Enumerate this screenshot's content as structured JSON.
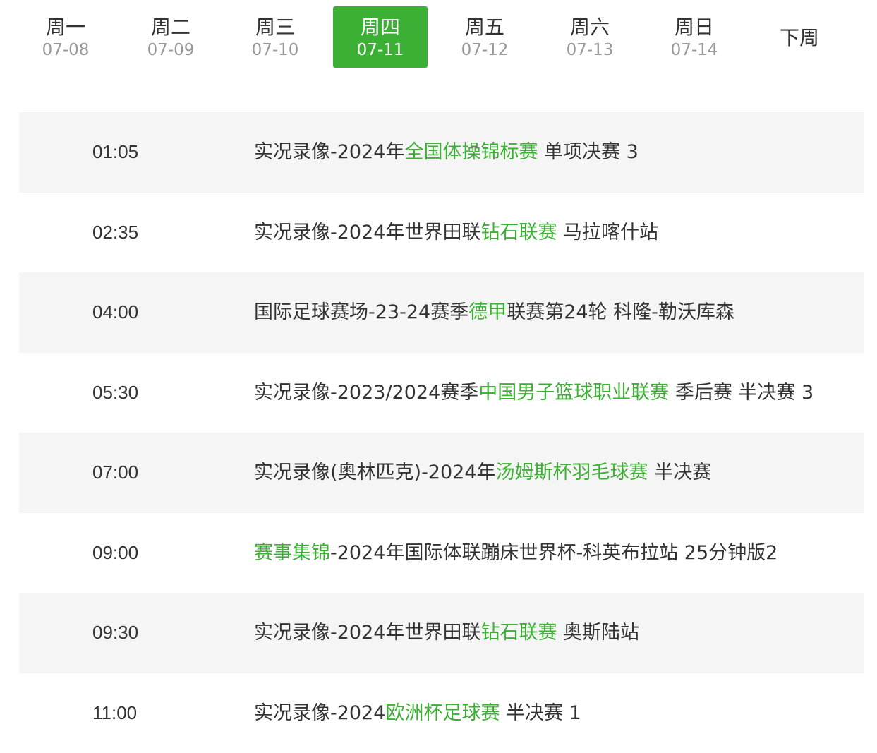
{
  "day_tabs": [
    {
      "weekday": "周一",
      "date": "07-08",
      "active": false
    },
    {
      "weekday": "周二",
      "date": "07-09",
      "active": false
    },
    {
      "weekday": "周三",
      "date": "07-10",
      "active": false
    },
    {
      "weekday": "周四",
      "date": "07-11",
      "active": true
    },
    {
      "weekday": "周五",
      "date": "07-12",
      "active": false
    },
    {
      "weekday": "周六",
      "date": "07-13",
      "active": false
    },
    {
      "weekday": "周日",
      "date": "07-14",
      "active": false
    }
  ],
  "next_week_label": "下周",
  "colors": {
    "accent": "#3cb034",
    "row_shade": "#f5f5f5",
    "text": "#333333",
    "muted": "#999999"
  },
  "schedule": [
    {
      "time": "01:05",
      "before": "实况录像-2024年",
      "highlight": "全国体操锦标赛",
      "after": " 单项决赛 3",
      "shaded": true
    },
    {
      "time": "02:35",
      "before": "实况录像-2024年世界田联",
      "highlight": "钻石联赛",
      "after": " 马拉喀什站",
      "shaded": false
    },
    {
      "time": "04:00",
      "before": "国际足球赛场-23-24赛季",
      "highlight": "德甲",
      "after": "联赛第24轮 科隆-勒沃库森",
      "shaded": true
    },
    {
      "time": "05:30",
      "before": "实况录像-2023/2024赛季",
      "highlight": "中国男子篮球职业联赛",
      "after": " 季后赛 半决赛 3",
      "shaded": false
    },
    {
      "time": "07:00",
      "before": "实况录像(奥林匹克)-2024年",
      "highlight": "汤姆斯杯羽毛球赛",
      "after": " 半决赛",
      "shaded": true
    },
    {
      "time": "09:00",
      "before": "",
      "highlight": "赛事集锦",
      "after": "-2024年国际体联蹦床世界杯-科英布拉站 25分钟版2",
      "shaded": false
    },
    {
      "time": "09:30",
      "before": "实况录像-2024年世界田联",
      "highlight": "钻石联赛",
      "after": " 奥斯陆站",
      "shaded": true
    },
    {
      "time": "11:00",
      "before": "实况录像-2024",
      "highlight": "欧洲杯足球赛",
      "after": " 半决赛 1",
      "shaded": false
    }
  ]
}
